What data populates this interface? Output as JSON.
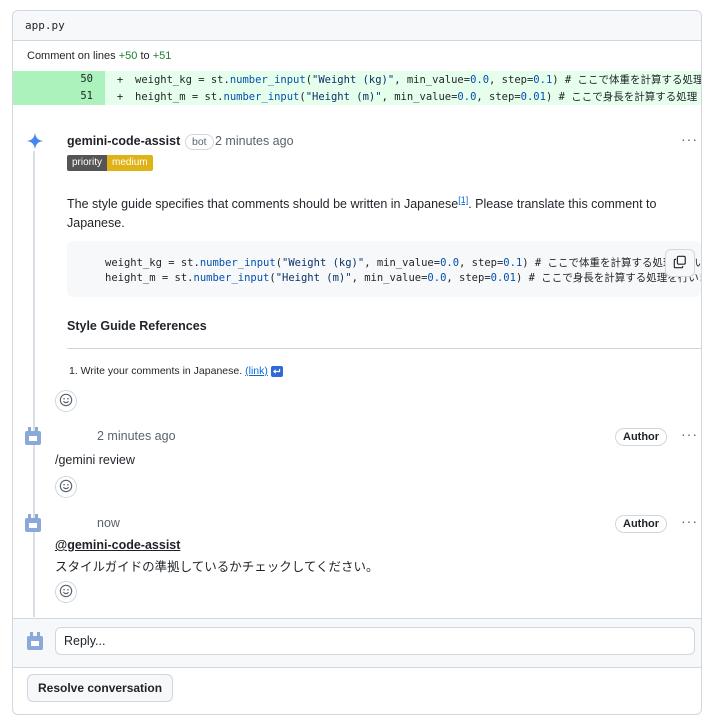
{
  "file": {
    "name": "app.py"
  },
  "comment_range": {
    "prefix": "Comment on lines",
    "start": "+50",
    "connector": "to",
    "end": "+51"
  },
  "diff": {
    "lines": [
      {
        "num": "50",
        "sign": "+",
        "pre": "    weight_kg = st.",
        "fn": "number_input",
        "mid1": "(",
        "str": "\"Weight (kg)\"",
        "mid2": ", min_value=",
        "n1": "0.0",
        "mid3": ", step=",
        "n2": "0.1",
        "post": ") # ここで体重を計算する処理"
      },
      {
        "num": "51",
        "sign": "+",
        "pre": "    height_m = st.",
        "fn": "number_input",
        "mid1": "(",
        "str": "\"Height (m)\"",
        "mid2": ", min_value=",
        "n1": "0.0",
        "mid3": ", step=",
        "n2": "0.01",
        "post": ")  # ここで身長を計算する処理"
      }
    ]
  },
  "bot_comment": {
    "username": "gemini-code-assist",
    "badge": "bot",
    "time": "2 minutes ago",
    "priority_key": "priority",
    "priority_value": "medium",
    "text_before": "The style guide specifies that comments should be written in Japanese",
    "footnote": "[1]",
    "text_after": ". Please translate this comment to Japanese.",
    "suggestion": [
      {
        "pre": "weight_kg = st.",
        "fn": "number_input",
        "mid1": "(",
        "str": "\"Weight (kg)\"",
        "mid2": ", min_value=",
        "n1": "0.0",
        "mid3": ", step=",
        "n2": "0.1",
        "post": ")  # ここで体重を計算する処理を行います"
      },
      {
        "pre": "height_m = st.",
        "fn": "number_input",
        "mid1": "(",
        "str": "\"Height (m)\"",
        "mid2": ", min_value=",
        "n1": "0.0",
        "mid3": ", step=",
        "n2": "0.01",
        "post": ")  # ここで身長を計算する処理を行います"
      }
    ],
    "sg_title": "Style Guide References",
    "sg_item_text": "1. Write your comments in Japanese.",
    "sg_item_link": "(link)"
  },
  "comment2": {
    "time": "2 minutes ago",
    "badge": "Author",
    "text": "/gemini review"
  },
  "comment3": {
    "time": "now",
    "badge": "Author",
    "mention": "@gemini-code-assist",
    "text": "スタイルガイドの準拠しているかチェックしてください。"
  },
  "reply": {
    "placeholder": "Reply..."
  },
  "resolve": {
    "label": "Resolve conversation"
  },
  "colors": {
    "accent": "#0969da",
    "diff_add_bg": "#e6ffec",
    "diff_num_bg": "#abf2bc",
    "priority_medium": "#dfb317",
    "gemini_star": "#4285f4"
  }
}
